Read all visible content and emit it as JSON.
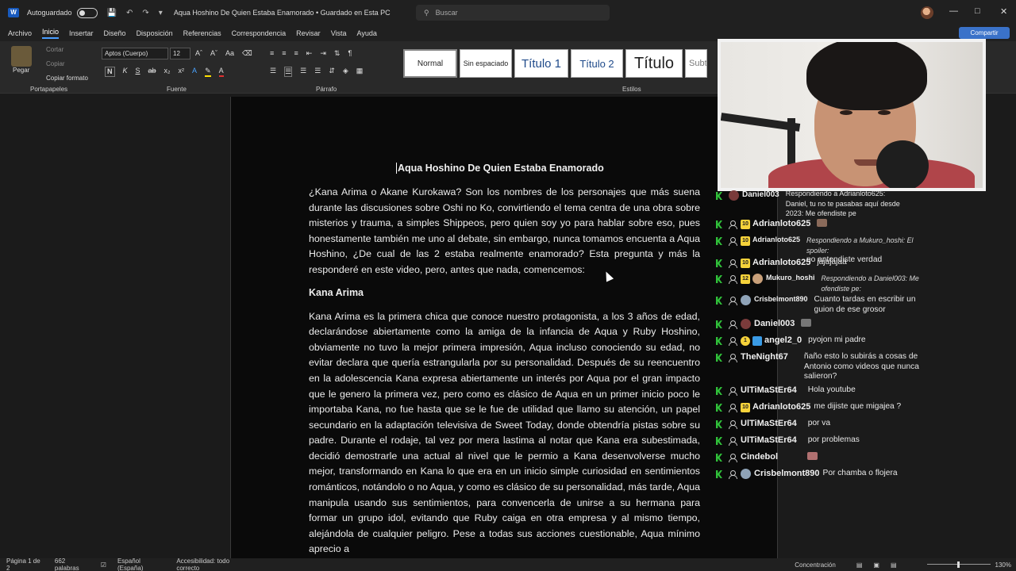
{
  "titlebar": {
    "autosave": "Autoguardado",
    "doc_title": "Aqua Hoshino De Quien Estaba Enamorado • Guardado en Esta PC",
    "search_placeholder": "Buscar"
  },
  "menu": [
    "Archivo",
    "Inicio",
    "Insertar",
    "Diseño",
    "Disposición",
    "Referencias",
    "Correspondencia",
    "Revisar",
    "Vista",
    "Ayuda"
  ],
  "share_label": "Compartir",
  "ribbon": {
    "paste": "Pegar",
    "cut": "Cortar",
    "copy": "Copiar",
    "format_painter": "Copiar formato",
    "font_name": "Aptos (Cuerpo)",
    "font_size": "12",
    "groups": {
      "clipboard": "Portapapeles",
      "font": "Fuente",
      "paragraph": "Párrafo",
      "styles": "Estilos"
    },
    "styles": [
      "Normal",
      "Sin espaciado",
      "Título 1",
      "Título 2",
      "Título",
      "Subtí"
    ]
  },
  "document": {
    "title": "Aqua Hoshino De Quien Estaba Enamorado",
    "p1": "¿Kana Arima o Akane Kurokawa? Son los nombres de los personajes que más suena durante las discusiones sobre Oshi no Ko, convirtiendo el tema centra de una obra sobre misterios y trauma, a simples Shippeos, pero quien soy yo para hablar sobre eso, pues honestamente también me uno al debate, sin embargo, nunca tomamos encuenta a Aqua Hoshino, ¿De cual de las 2 estaba realmente enamorado? Esta pregunta y más la responderé en este video, pero, antes que nada, comencemos:",
    "h1": "Kana Arima",
    "p2": "Kana Arima es la primera chica que conoce nuestro protagonista, a los 3 años de edad, declarándose abiertamente como la amiga de la infancia de Aqua y Ruby Hoshino, obviamente no tuvo la mejor primera impresión, Aqua incluso conociendo su edad, no evitar declara que quería estrangularla por su personalidad. Después de su reencuentro en la adolescencia Kana expresa abiertamente un interés por Aqua por el gran impacto que le genero la primera vez, pero como es clásico de Aqua en un primer inicio poco le importaba Kana, no fue hasta que se le fue de utilidad que llamo su atención, un papel secundario en la adaptación televisiva de Sweet Today, donde obtendría pistas sobre su padre. Durante el rodaje, tal vez por mera lastima al notar que Kana era subestimada, decidió demostrarle una actual al nivel que le permio a Kana desenvolverse mucho mejor, transformando en Kana lo que era en un inicio simple curiosidad en sentimientos románticos, notándolo o no Aqua, y como es clásico de su personalidad, más tarde, Aqua manipula usando sus sentimientos, para convencerla de unirse a su hermana para formar un grupo idol, evitando que Ruby caiga en otra empresa y al mismo tiempo, alejándola de cualquier peligro. Pese a todas sus acciones cuestionable, Aqua mínimo aprecio a"
  },
  "chat": {
    "messages": [
      {
        "user": "Daniel003",
        "text": "Respondiendo a Adrianloto625: Daniel, tu no te pasabas aquí desde 2023: Me ofendiste pe"
      },
      {
        "user": "Adrianloto625",
        "badge": "10",
        "text": ""
      },
      {
        "user": "Adrianloto625",
        "badge": "10",
        "reply": "Respondiendo a Mukuro_hoshi: El spoiler:",
        "text": "no entendiste verdad"
      },
      {
        "user": "Adrianloto625",
        "badge": "10",
        "text": "jajajajaa"
      },
      {
        "user": "Mukuro_hoshi",
        "badge": "12",
        "reply": "Respondiendo a Daniel003: Me ofendiste pe:",
        "text": ""
      },
      {
        "user": "Crisbelmont890",
        "text": "Cuanto tardas en escribir un guion de ese grosor"
      },
      {
        "user": "Daniel003",
        "text": ""
      },
      {
        "user": "angel2_0",
        "badge": "1",
        "text": "pyojon mi padre"
      },
      {
        "user": "TheNight67",
        "text": "ñaño esto lo subirás a cosas de Antonio como videos que nunca salieron?"
      },
      {
        "user": "UlTiMaStEr64",
        "text": "Hola youtube"
      },
      {
        "user": "Adrianloto625",
        "badge": "10",
        "text": "me dijiste que migajea ?"
      },
      {
        "user": "UlTiMaStEr64",
        "text": "por va"
      },
      {
        "user": "UlTiMaStEr64",
        "text": "por problemas"
      },
      {
        "user": "Cindebol",
        "text": ""
      },
      {
        "user": "Crisbelmont890",
        "text": "Por chamba o flojera"
      }
    ]
  },
  "status": {
    "page": "Página 1 de 2",
    "words": "662 palabras",
    "language": "Español (España)",
    "accessibility": "Accesibilidad: todo correcto",
    "focus": "Concentración",
    "zoom": "130%"
  }
}
